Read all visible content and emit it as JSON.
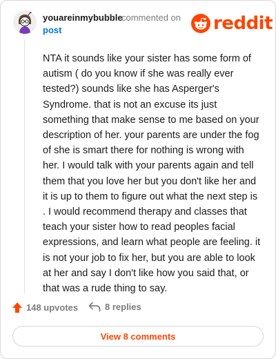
{
  "comment": {
    "username": "youareinmybubble",
    "action_text": "commented on",
    "post_link": "post",
    "body": "NTA it sounds like your sister has some form of autism ( do you know if she was really ever tested?) sounds like she has Asperger's Syndrome. that is not an excuse its just something that make sense to me based on your description of her. your parents are under the fog of she is smart there for nothing is wrong with her. I would talk with your parents again and tell them that you love her but you don't like her and it is up to them to figure out what the next step is . I would recommend therapy and classes that teach your sister how to read peoples facial expressions, and learn what people are feeling. it is not your job to fix her, but you are able to look at her and say I don't like how you said that, or that was a rude thing to say."
  },
  "brand": {
    "name": "reddit",
    "color": "#ff4500"
  },
  "footer": {
    "upvotes": "148 upvotes",
    "replies": "8 replies",
    "view_comments": "View 8 comments"
  },
  "icons": {
    "avatar": "snoo-avatar-icon",
    "logo": "reddit-logo-icon",
    "upvote": "upvote-arrow-icon",
    "reply": "reply-arrow-icon"
  }
}
